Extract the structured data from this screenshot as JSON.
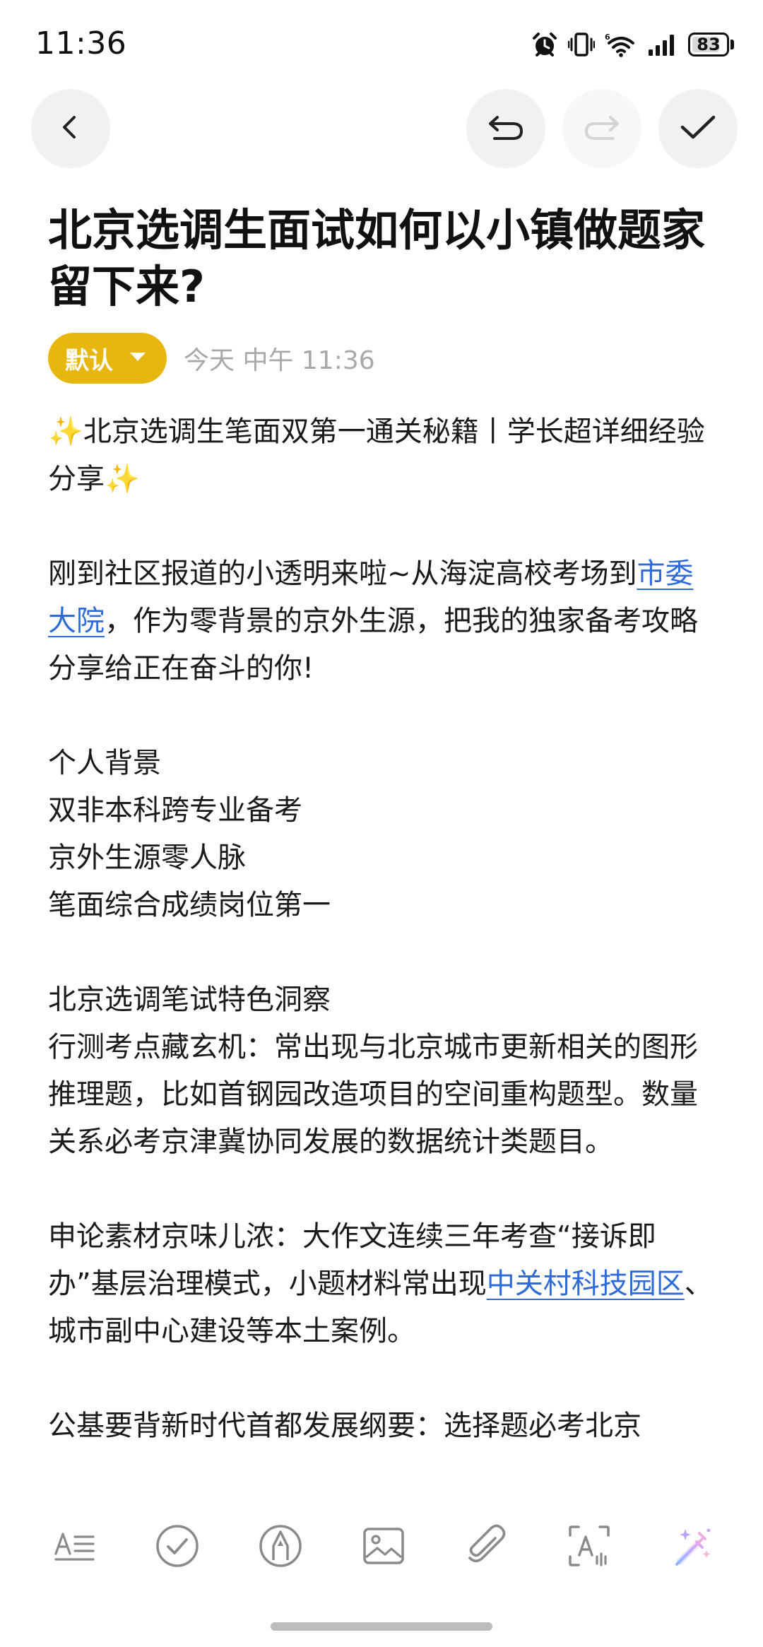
{
  "status_bar": {
    "time": "11:36",
    "battery_level": "83",
    "battery_fraction": 0.83,
    "icons": [
      "alarm-icon",
      "vibrate-icon",
      "wifi-icon",
      "signal-icon",
      "battery-icon"
    ]
  },
  "toolbar": {
    "icons": [
      "back-icon",
      "undo-icon",
      "redo-icon",
      "check-icon"
    ]
  },
  "note": {
    "title": "北京选调生面试如何以小镇做题家留下来?",
    "folder": "默认",
    "timestamp": "今天 中午 11:36",
    "body": {
      "heading_prefix": "✨",
      "heading": "北京选调生笔面双第一通关秘籍丨学长超详细经验分享",
      "heading_suffix": "✨",
      "intro_1": "刚到社区报道的小透明来啦~从海淀高校考场到",
      "intro_link": "市委大院",
      "intro_2": "，作为零背景的京外生源，把我的独家备考攻略分享给正在奋斗的你!",
      "bg_title": "个人背景",
      "bg_1": "双非本科跨专业备考",
      "bg_2": "京外生源零人脉",
      "bg_3": "笔面综合成绩岗位第一",
      "exam_title": "北京选调笔试特色洞察",
      "exam_1": "行测考点藏玄机：常出现与北京城市更新相关的图形推理题，比如首钢园改造项目的空间重构题型。数量关系必考京津冀协同发展的数据统计类题目。",
      "essay_1": "申论素材京味儿浓：大作文连续三年考查“接诉即办”基层治理模式，小题材料常出现",
      "essay_link": "中关村科技园区",
      "essay_2": "、城市副中心建设等本土案例。",
      "basic_1": "公基要背新时代首都发展纲要：选择题必考北京"
    }
  },
  "bottom_toolbar": {
    "icons": [
      "text-format-icon",
      "checklist-icon",
      "pen-icon",
      "image-icon",
      "attachment-icon",
      "text-scan-icon",
      "ai-magic-icon"
    ]
  },
  "colors": {
    "accent": "#e8b70f",
    "link": "#2f6bd8",
    "meta_text": "#a8a8a8",
    "button_bg": "#f1f1f1"
  }
}
